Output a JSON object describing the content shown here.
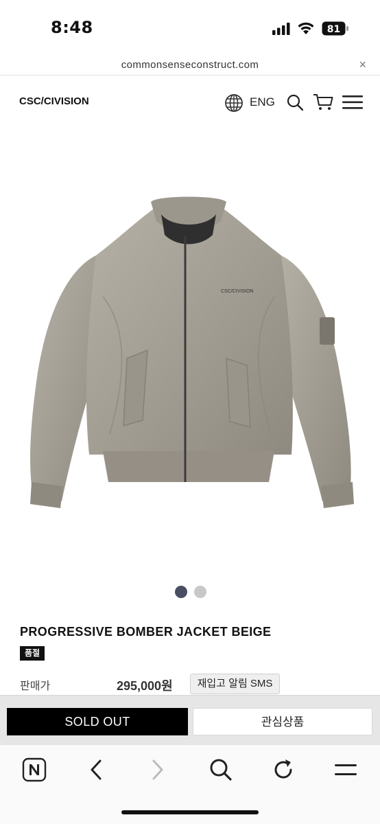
{
  "status_bar": {
    "time": "8:48",
    "battery_level": "81",
    "icons": [
      "signal-icon",
      "wifi-icon",
      "battery-icon"
    ]
  },
  "browser": {
    "url": "commonsenseconstruct.com",
    "close_glyph": "×",
    "toolbar_icons": [
      "naver-home-icon",
      "back-icon",
      "forward-icon",
      "search-icon",
      "reload-icon",
      "menu-icon"
    ]
  },
  "site_header": {
    "logo": "CSC/CIVISION",
    "language": "ENG",
    "icons": [
      "globe-icon",
      "search-icon",
      "cart-icon",
      "hamburger-menu-icon"
    ]
  },
  "product": {
    "image_label": "CSC/CIVISION",
    "gallery_total": 2,
    "gallery_active": 1,
    "name": "PROGRESSIVE BOMBER JACKET BEIGE",
    "badge": "품절",
    "price_label": "판매가",
    "price": "295,000원",
    "restock_button": "재입고 알림 SMS"
  },
  "actions": {
    "sold_out": "SOLD OUT",
    "wishlist": "관심상품"
  },
  "colors": {
    "accent_dark": "#000000",
    "dot_active": "#4a4e63",
    "dot_inactive": "#c8c8c8",
    "jacket": "#a8a398"
  }
}
